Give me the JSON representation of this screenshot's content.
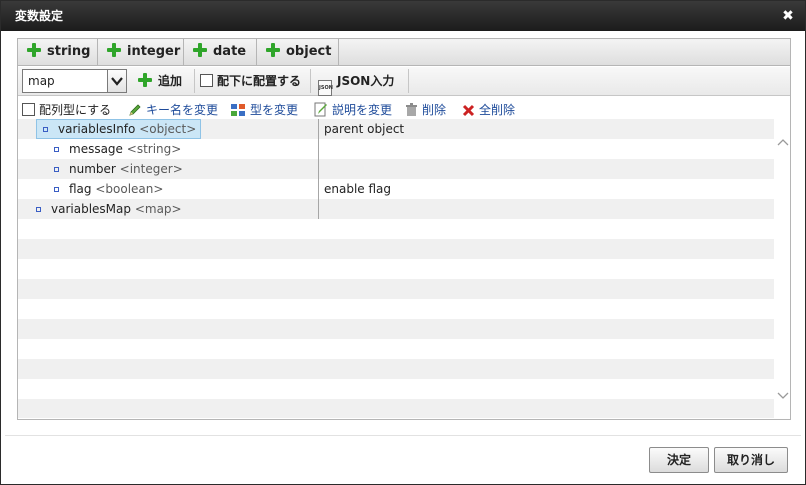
{
  "dialog": {
    "title": "変数設定",
    "close_glyph": "✖"
  },
  "type_buttons": [
    {
      "label": "string"
    },
    {
      "label": "integer"
    },
    {
      "label": "date"
    },
    {
      "label": "object"
    }
  ],
  "toolbar": {
    "select_value": "map",
    "add_label": "追加",
    "place_under_label": "配下に配置する",
    "json_label": "JSON入力",
    "json_icon_text": "JSON"
  },
  "actions": {
    "array_label": "配列型にする",
    "rename_label": "キー名を変更",
    "change_type_label": "型を変更",
    "change_desc_label": "説明を変更",
    "delete_label": "削除",
    "delete_all_label": "全削除"
  },
  "tree": [
    {
      "name": "variablesInfo",
      "type": "<object>",
      "description": "parent object",
      "depth": 1,
      "selected": true
    },
    {
      "name": "message",
      "type": "<string>",
      "description": "",
      "depth": 2,
      "selected": false
    },
    {
      "name": "number",
      "type": "<integer>",
      "description": "",
      "depth": 2,
      "selected": false
    },
    {
      "name": "flag",
      "type": "<boolean>",
      "description": "enable flag",
      "depth": 2,
      "selected": false
    },
    {
      "name": "variablesMap",
      "type": "<map>",
      "description": "",
      "depth": 1,
      "selected": false
    }
  ],
  "footer": {
    "ok_label": "決定",
    "cancel_label": "取り消し"
  },
  "colors": {
    "titlebar": "#2a2a2a",
    "plus_icon": "#2fa52a",
    "link_text": "#1e4b9a",
    "selected_row": "#cbe6f6",
    "delete_all_icon": "#cc2222"
  }
}
